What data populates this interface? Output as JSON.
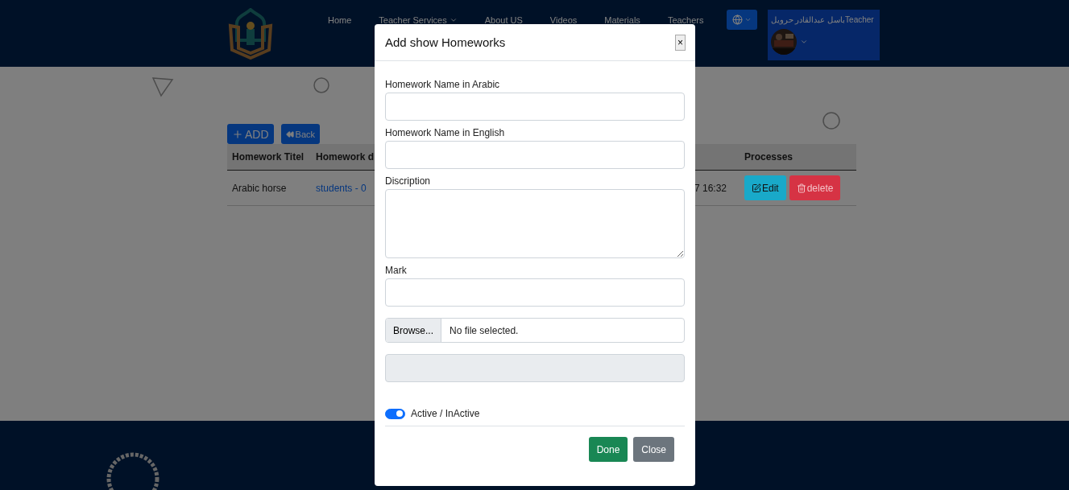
{
  "header": {
    "nav": [
      {
        "label": "Home",
        "kind": "link"
      },
      {
        "label": "Teacher Services",
        "kind": "dropdown"
      },
      {
        "label": "About US",
        "kind": "link"
      },
      {
        "label": "Videos",
        "kind": "link"
      },
      {
        "label": "Materials",
        "kind": "link"
      },
      {
        "label": "Teachers",
        "kind": "link"
      }
    ],
    "user": {
      "name": "باسل عبدالقادر حرويلTeacher"
    }
  },
  "toolbar": {
    "buttons": [
      {
        "label": "ADD",
        "kind": "add"
      },
      {
        "label": "Back",
        "kind": "back"
      }
    ]
  },
  "table": {
    "columns": [
      "Homework Titel",
      "Homework d",
      "",
      "Processes"
    ],
    "rows": [
      {
        "cells": [
          "Arabic horse",
          "students - 0",
          "7 16:32"
        ],
        "actions": [
          {
            "label": "Edit",
            "kind": "edit"
          },
          {
            "label": "delete",
            "kind": "delete"
          }
        ]
      }
    ]
  },
  "modal": {
    "title": "Add show Homeworks",
    "close": "×",
    "fields": [
      {
        "kind": "text",
        "label": "Homework Name in Arabic"
      },
      {
        "kind": "text",
        "label": "Homework Name in English"
      },
      {
        "kind": "textarea",
        "label": "Discription"
      },
      {
        "kind": "text",
        "label": "Mark"
      },
      {
        "kind": "file",
        "button": "Browse...",
        "value": "No file selected."
      },
      {
        "kind": "disabled"
      }
    ],
    "switch": {
      "label": "Active / InActive",
      "on": true
    },
    "buttons": [
      {
        "label": "Done",
        "kind": "primary"
      },
      {
        "label": "Close",
        "kind": "secondary"
      }
    ]
  }
}
